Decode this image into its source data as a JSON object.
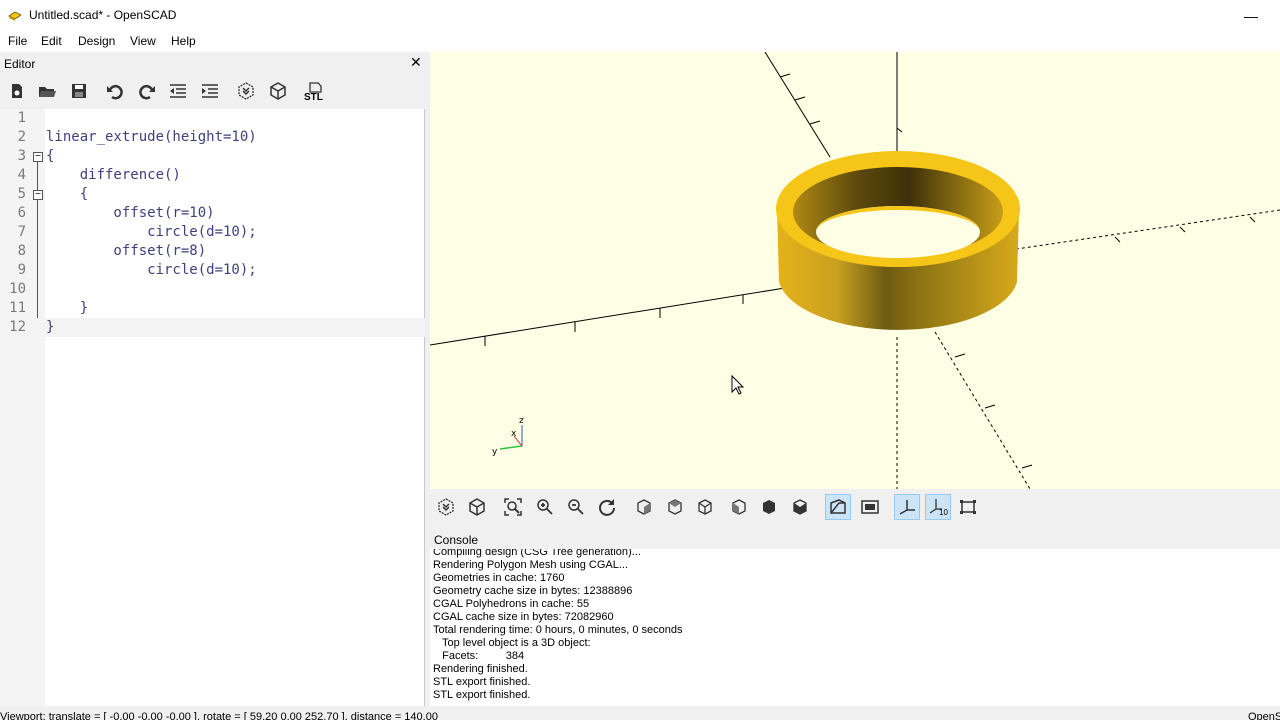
{
  "window": {
    "title": "Untitled.scad* - OpenSCAD",
    "minimize_glyph": "—"
  },
  "menu": {
    "items": [
      "File",
      "Edit",
      "Design",
      "View",
      "Help"
    ]
  },
  "editor": {
    "title": "Editor",
    "close_glyph": "✕",
    "toolbar_icons": [
      "new-file-icon",
      "open-file-icon",
      "save-icon",
      "undo-icon",
      "redo-icon",
      "unindent-icon",
      "indent-icon",
      "preview-icon",
      "render-icon",
      "export-stl-icon"
    ],
    "stl_label": "STL",
    "lines": [
      {
        "n": "1",
        "text": ""
      },
      {
        "n": "2",
        "text": "linear_extrude(height=10)"
      },
      {
        "n": "3",
        "text": "{"
      },
      {
        "n": "4",
        "text": "    difference()"
      },
      {
        "n": "5",
        "text": "    {"
      },
      {
        "n": "6",
        "text": "        offset(r=10)"
      },
      {
        "n": "7",
        "text": "            circle(d=10);"
      },
      {
        "n": "8",
        "text": "        offset(r=8)"
      },
      {
        "n": "9",
        "text": "            circle(d=10);"
      },
      {
        "n": "10",
        "text": ""
      },
      {
        "n": "11",
        "text": "    }"
      },
      {
        "n": "12",
        "text": "}"
      }
    ]
  },
  "viewport": {
    "axis_label_z": "z",
    "axis_label_x": "x",
    "axis_label_y": "y",
    "background_color": "#ffffe5",
    "object_color": "#f5c518"
  },
  "view_toolbar": {
    "icons": [
      "preview-icon",
      "render-icon",
      "view-all-icon",
      "zoom-in-icon",
      "zoom-out-icon",
      "reset-view-icon",
      "view-right-icon",
      "view-top-icon",
      "view-bottom-icon",
      "view-left-icon",
      "view-front-icon",
      "view-back-icon",
      "perspective-icon",
      "orthogonal-icon",
      "show-axes-icon",
      "show-scale-markers-icon",
      "show-edges-icon"
    ],
    "active": [
      "perspective-icon",
      "show-axes-icon",
      "show-scale-markers-icon"
    ],
    "scale_label": "10"
  },
  "console": {
    "title": "Console",
    "lines": [
      "Compiling design (CSG Tree generation)...",
      "Rendering Polygon Mesh using CGAL...",
      "Geometries in cache: 1760",
      "Geometry cache size in bytes: 12388896",
      "CGAL Polyhedrons in cache: 55",
      "CGAL cache size in bytes: 72082960",
      "Total rendering time: 0 hours, 0 minutes, 0 seconds",
      "   Top level object is a 3D object:",
      "   Facets:         384",
      "Rendering finished.",
      "STL export finished.",
      "STL export finished."
    ]
  },
  "statusbar": {
    "left": "Viewport: translate = [ -0.00 -0.00 -0.00 ], rotate = [ 59.20 0.00 252.70 ], distance = 140.00",
    "right": "OpenS"
  }
}
